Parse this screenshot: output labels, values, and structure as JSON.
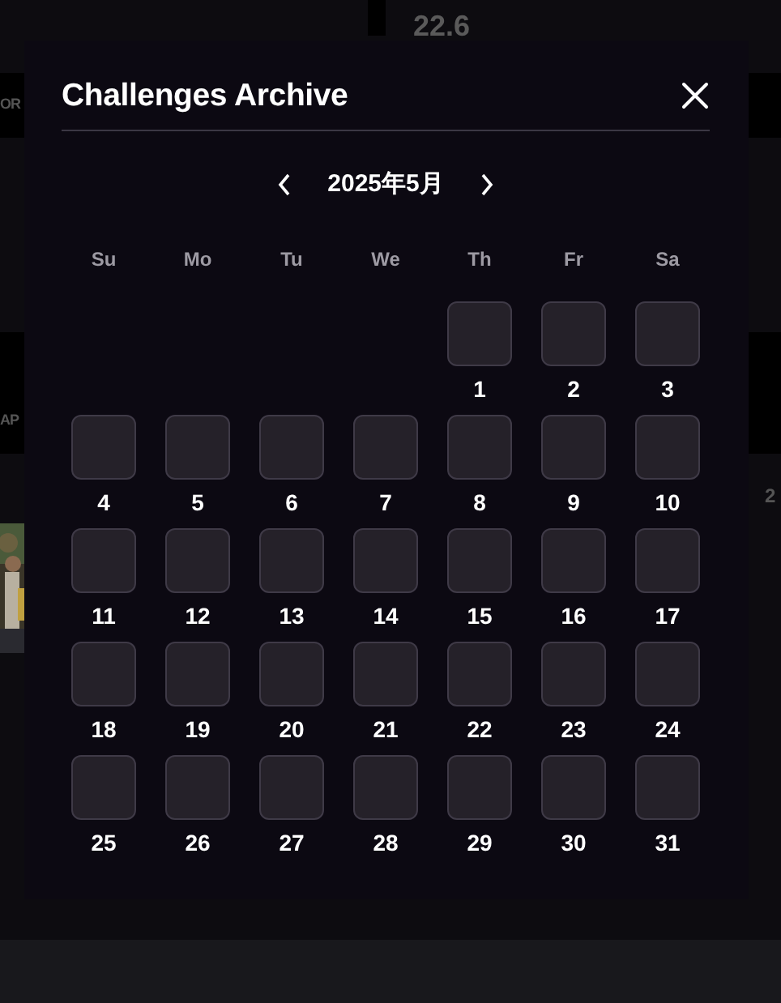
{
  "background": {
    "texts": [
      {
        "text": "22.6",
        "kind": "stat"
      },
      {
        "text": "OR",
        "kind": "left"
      },
      {
        "text": "AP",
        "kind": "left2"
      },
      {
        "text": "2",
        "kind": "right"
      }
    ]
  },
  "modal": {
    "title": "Challenges Archive",
    "month": "2025年5月",
    "weekdays": [
      "Su",
      "Mo",
      "Tu",
      "We",
      "Th",
      "Fr",
      "Sa"
    ],
    "days": [
      {
        "kind": "blank"
      },
      {
        "kind": "blank"
      },
      {
        "kind": "blank"
      },
      {
        "kind": "blank"
      },
      {
        "kind": "day",
        "label": "1"
      },
      {
        "kind": "day",
        "label": "2"
      },
      {
        "kind": "day",
        "label": "3"
      },
      {
        "kind": "day",
        "label": "4"
      },
      {
        "kind": "day",
        "label": "5"
      },
      {
        "kind": "day",
        "label": "6"
      },
      {
        "kind": "day",
        "label": "7"
      },
      {
        "kind": "day",
        "label": "8"
      },
      {
        "kind": "day",
        "label": "9"
      },
      {
        "kind": "day",
        "label": "10"
      },
      {
        "kind": "day",
        "label": "11"
      },
      {
        "kind": "day",
        "label": "12"
      },
      {
        "kind": "day",
        "label": "13"
      },
      {
        "kind": "day",
        "label": "14"
      },
      {
        "kind": "day",
        "label": "15"
      },
      {
        "kind": "day",
        "label": "16"
      },
      {
        "kind": "day",
        "label": "17"
      },
      {
        "kind": "day",
        "label": "18"
      },
      {
        "kind": "day",
        "label": "19"
      },
      {
        "kind": "day",
        "label": "20"
      },
      {
        "kind": "day",
        "label": "21"
      },
      {
        "kind": "day",
        "label": "22"
      },
      {
        "kind": "day",
        "label": "23"
      },
      {
        "kind": "day",
        "label": "24"
      },
      {
        "kind": "day",
        "label": "25"
      },
      {
        "kind": "day",
        "label": "26"
      },
      {
        "kind": "day",
        "label": "27"
      },
      {
        "kind": "day",
        "label": "28"
      },
      {
        "kind": "day",
        "label": "29"
      },
      {
        "kind": "day",
        "label": "30"
      },
      {
        "kind": "day",
        "label": "31"
      }
    ]
  }
}
